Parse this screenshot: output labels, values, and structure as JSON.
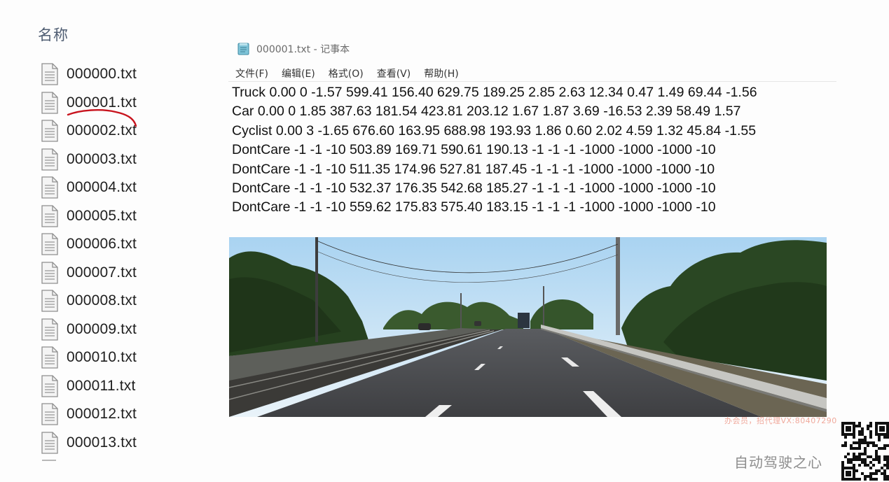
{
  "explorer": {
    "column_header": "名称",
    "files": [
      "000000.txt",
      "000001.txt",
      "000002.txt",
      "000003.txt",
      "000004.txt",
      "000005.txt",
      "000006.txt",
      "000007.txt",
      "000008.txt",
      "000009.txt",
      "000010.txt",
      "000011.txt",
      "000012.txt",
      "000013.txt"
    ],
    "highlighted_file": "000001.txt"
  },
  "notepad": {
    "title": "000001.txt - 记事本",
    "menu": [
      "文件(F)",
      "编辑(E)",
      "格式(O)",
      "查看(V)",
      "帮助(H)"
    ],
    "lines": [
      "Truck 0.00 0 -1.57 599.41 156.40 629.75 189.25 2.85 2.63 12.34 0.47 1.49 69.44 -1.56",
      "Car 0.00 0 1.85 387.63 181.54 423.81 203.12 1.67 1.87 3.69 -16.53 2.39 58.49 1.57",
      "Cyclist 0.00 3 -1.65 676.60 163.95 688.98 193.93 1.86 0.60 2.02 4.59 1.32 45.84 -1.55",
      "DontCare -1 -1 -10 503.89 169.71 590.61 190.13 -1 -1 -1 -1000 -1000 -1000 -10",
      "DontCare -1 -1 -10 511.35 174.96 527.81 187.45 -1 -1 -1 -1000 -1000 -1000 -10",
      "DontCare -1 -1 -10 532.37 176.35 542.68 185.27 -1 -1 -1 -1000 -1000 -1000 -10",
      "DontCare -1 -1 -10 559.62 175.83 575.40 183.15 -1 -1 -1 -1000 -1000 -1000 -10"
    ]
  },
  "watermark": {
    "ad_text": "办会员，招代理VX:80407290",
    "brand": "自动驾驶之心"
  },
  "colors": {
    "annotation": "#c8141e",
    "sky": "#cfe6f7",
    "vegetation": "#2c4a24",
    "road": "#48494c"
  }
}
